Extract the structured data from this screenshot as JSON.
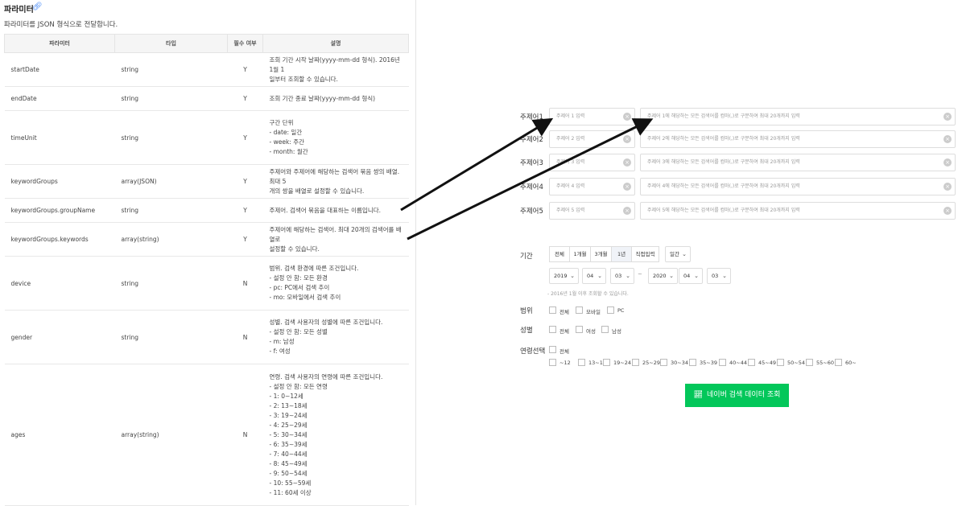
{
  "doc": {
    "title": "파라미터",
    "description": "파라미터를 JSON 형식으로 전달합니다.",
    "headers": [
      "파라미터",
      "타입",
      "필수 여부",
      "설명"
    ],
    "rows": [
      {
        "name": "startDate",
        "type": "string",
        "required": "Y",
        "desc": [
          "조회 기간 시작 날짜(yyyy-mm-dd 형식). 2016년 1월 1",
          "일부터 조회할 수 있습니다."
        ]
      },
      {
        "name": "endDate",
        "type": "string",
        "required": "Y",
        "desc": [
          "조회 기간 종료 날짜(yyyy-mm-dd 형식)"
        ]
      },
      {
        "name": "timeUnit",
        "type": "string",
        "required": "Y",
        "desc": [
          "구간 단위",
          "- date: 일간",
          "- week: 주간",
          "- month: 월간"
        ]
      },
      {
        "name": "keywordGroups",
        "type": "array(JSON)",
        "required": "Y",
        "desc": [
          "주제어와 주제어에 해당하는 검색어 묶음 쌍의 배열. 최대 5",
          "개의 쌍을 배열로 설정할 수 있습니다."
        ]
      },
      {
        "name": "keywordGroups.groupName",
        "type": "string",
        "required": "Y",
        "desc": [
          "주제어. 검색어 묶음을 대표하는 이름입니다."
        ]
      },
      {
        "name": "keywordGroups.keywords",
        "type": "array(string)",
        "required": "Y",
        "desc": [
          "주제어에 해당하는 검색어. 최대 20개의 검색어를 배열로",
          "설정할 수 있습니다."
        ]
      },
      {
        "name": "device",
        "type": "string",
        "required": "N",
        "desc": [
          "범위. 검색 환경에 따른 조건입니다.",
          "- 설정 안 함: 모든 환경",
          "- pc: PC에서 검색 추이",
          "- mo: 모바일에서 검색 추이"
        ]
      },
      {
        "name": "gender",
        "type": "string",
        "required": "N",
        "desc": [
          "성별. 검색 사용자의 성별에 따른 조건입니다.",
          "- 설정 안 함: 모든 성별",
          "- m: 남성",
          "- f: 여성"
        ]
      },
      {
        "name": "ages",
        "type": "array(string)",
        "required": "N",
        "desc": [
          "연령. 검색 사용자의 연령에 따른 조건입니다.",
          "- 설정 안 함: 모든 연령",
          "- 1: 0∼12세",
          "- 2: 13∼18세",
          "- 3: 19∼24세",
          "- 4: 25∼29세",
          "- 5: 30∼34세",
          "- 6: 35∼39세",
          "- 7: 40∼44세",
          "- 8: 45∼49세",
          "- 9: 50∼54세",
          "- 10: 55∼59세",
          "- 11: 60세 이상"
        ]
      }
    ]
  },
  "form": {
    "topics": [
      {
        "label": "주제어1",
        "topic_placeholder": "주제어 1 입력",
        "keywords_placeholder": "주제어 1에 해당하는 모든 검색어를 컴마(,)로 구분하여 최대 20개까지 입력"
      },
      {
        "label": "주제어2",
        "topic_placeholder": "주제어 2 입력",
        "keywords_placeholder": "주제어 2에 해당하는 모든 검색어를 컴마(,)로 구분하여 최대 20개까지 입력"
      },
      {
        "label": "주제어3",
        "topic_placeholder": "주제어 3 입력",
        "keywords_placeholder": "주제어 3에 해당하는 모든 검색어를 컴마(,)로 구분하여 최대 20개까지 입력"
      },
      {
        "label": "주제어4",
        "topic_placeholder": "주제어 4 입력",
        "keywords_placeholder": "주제어 4에 해당하는 모든 검색어를 컴마(,)로 구분하여 최대 20개까지 입력"
      },
      {
        "label": "주제어5",
        "topic_placeholder": "주제어 5 입력",
        "keywords_placeholder": "주제어 5에 해당하는 모든 검색어를 컴마(,)로 구분하여 최대 20개까지 입력"
      }
    ],
    "period_label": "기간",
    "period_buttons": [
      "전체",
      "1개월",
      "3개월",
      "1년",
      "직접입력"
    ],
    "period_active": "1년",
    "time_unit": "일간",
    "start": {
      "year": "2019",
      "month": "04",
      "day": "03"
    },
    "end": {
      "year": "2020",
      "month": "04",
      "day": "03"
    },
    "range_separator": "~",
    "note": "- 2016년 1월 이후 조회할 수 있습니다.",
    "device_label": "범위",
    "device_options": [
      "전체",
      "모바일",
      "PC"
    ],
    "gender_label": "성별",
    "gender_options": [
      "전체",
      "여성",
      "남성"
    ],
    "age_label": "연령선택",
    "age_all": "전체",
    "age_options": [
      "~12",
      "13~18",
      "19~24",
      "25~29",
      "30~34",
      "35~39",
      "40~44",
      "45~49",
      "50~54",
      "55~60",
      "60~"
    ],
    "submit_label": "네이버 검색 데이터 조회",
    "icons": {
      "link": "link-icon",
      "clear": "clear-icon",
      "chevron": "chevron-down-icon",
      "chart": "chart-line-icon"
    },
    "colors": {
      "accent": "#03c75a",
      "link": "#3b82f6"
    }
  }
}
